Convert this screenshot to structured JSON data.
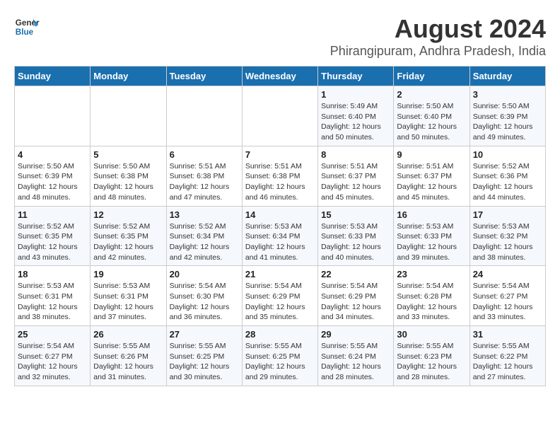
{
  "logo": {
    "line1": "General",
    "line2": "Blue"
  },
  "title": "August 2024",
  "subtitle": "Phirangipuram, Andhra Pradesh, India",
  "weekdays": [
    "Sunday",
    "Monday",
    "Tuesday",
    "Wednesday",
    "Thursday",
    "Friday",
    "Saturday"
  ],
  "weeks": [
    [
      {
        "day": "",
        "info": ""
      },
      {
        "day": "",
        "info": ""
      },
      {
        "day": "",
        "info": ""
      },
      {
        "day": "",
        "info": ""
      },
      {
        "day": "1",
        "info": "Sunrise: 5:49 AM\nSunset: 6:40 PM\nDaylight: 12 hours\nand 50 minutes."
      },
      {
        "day": "2",
        "info": "Sunrise: 5:50 AM\nSunset: 6:40 PM\nDaylight: 12 hours\nand 50 minutes."
      },
      {
        "day": "3",
        "info": "Sunrise: 5:50 AM\nSunset: 6:39 PM\nDaylight: 12 hours\nand 49 minutes."
      }
    ],
    [
      {
        "day": "4",
        "info": "Sunrise: 5:50 AM\nSunset: 6:39 PM\nDaylight: 12 hours\nand 48 minutes."
      },
      {
        "day": "5",
        "info": "Sunrise: 5:50 AM\nSunset: 6:38 PM\nDaylight: 12 hours\nand 48 minutes."
      },
      {
        "day": "6",
        "info": "Sunrise: 5:51 AM\nSunset: 6:38 PM\nDaylight: 12 hours\nand 47 minutes."
      },
      {
        "day": "7",
        "info": "Sunrise: 5:51 AM\nSunset: 6:38 PM\nDaylight: 12 hours\nand 46 minutes."
      },
      {
        "day": "8",
        "info": "Sunrise: 5:51 AM\nSunset: 6:37 PM\nDaylight: 12 hours\nand 45 minutes."
      },
      {
        "day": "9",
        "info": "Sunrise: 5:51 AM\nSunset: 6:37 PM\nDaylight: 12 hours\nand 45 minutes."
      },
      {
        "day": "10",
        "info": "Sunrise: 5:52 AM\nSunset: 6:36 PM\nDaylight: 12 hours\nand 44 minutes."
      }
    ],
    [
      {
        "day": "11",
        "info": "Sunrise: 5:52 AM\nSunset: 6:35 PM\nDaylight: 12 hours\nand 43 minutes."
      },
      {
        "day": "12",
        "info": "Sunrise: 5:52 AM\nSunset: 6:35 PM\nDaylight: 12 hours\nand 42 minutes."
      },
      {
        "day": "13",
        "info": "Sunrise: 5:52 AM\nSunset: 6:34 PM\nDaylight: 12 hours\nand 42 minutes."
      },
      {
        "day": "14",
        "info": "Sunrise: 5:53 AM\nSunset: 6:34 PM\nDaylight: 12 hours\nand 41 minutes."
      },
      {
        "day": "15",
        "info": "Sunrise: 5:53 AM\nSunset: 6:33 PM\nDaylight: 12 hours\nand 40 minutes."
      },
      {
        "day": "16",
        "info": "Sunrise: 5:53 AM\nSunset: 6:33 PM\nDaylight: 12 hours\nand 39 minutes."
      },
      {
        "day": "17",
        "info": "Sunrise: 5:53 AM\nSunset: 6:32 PM\nDaylight: 12 hours\nand 38 minutes."
      }
    ],
    [
      {
        "day": "18",
        "info": "Sunrise: 5:53 AM\nSunset: 6:31 PM\nDaylight: 12 hours\nand 38 minutes."
      },
      {
        "day": "19",
        "info": "Sunrise: 5:53 AM\nSunset: 6:31 PM\nDaylight: 12 hours\nand 37 minutes."
      },
      {
        "day": "20",
        "info": "Sunrise: 5:54 AM\nSunset: 6:30 PM\nDaylight: 12 hours\nand 36 minutes."
      },
      {
        "day": "21",
        "info": "Sunrise: 5:54 AM\nSunset: 6:29 PM\nDaylight: 12 hours\nand 35 minutes."
      },
      {
        "day": "22",
        "info": "Sunrise: 5:54 AM\nSunset: 6:29 PM\nDaylight: 12 hours\nand 34 minutes."
      },
      {
        "day": "23",
        "info": "Sunrise: 5:54 AM\nSunset: 6:28 PM\nDaylight: 12 hours\nand 33 minutes."
      },
      {
        "day": "24",
        "info": "Sunrise: 5:54 AM\nSunset: 6:27 PM\nDaylight: 12 hours\nand 33 minutes."
      }
    ],
    [
      {
        "day": "25",
        "info": "Sunrise: 5:54 AM\nSunset: 6:27 PM\nDaylight: 12 hours\nand 32 minutes."
      },
      {
        "day": "26",
        "info": "Sunrise: 5:55 AM\nSunset: 6:26 PM\nDaylight: 12 hours\nand 31 minutes."
      },
      {
        "day": "27",
        "info": "Sunrise: 5:55 AM\nSunset: 6:25 PM\nDaylight: 12 hours\nand 30 minutes."
      },
      {
        "day": "28",
        "info": "Sunrise: 5:55 AM\nSunset: 6:25 PM\nDaylight: 12 hours\nand 29 minutes."
      },
      {
        "day": "29",
        "info": "Sunrise: 5:55 AM\nSunset: 6:24 PM\nDaylight: 12 hours\nand 28 minutes."
      },
      {
        "day": "30",
        "info": "Sunrise: 5:55 AM\nSunset: 6:23 PM\nDaylight: 12 hours\nand 28 minutes."
      },
      {
        "day": "31",
        "info": "Sunrise: 5:55 AM\nSunset: 6:22 PM\nDaylight: 12 hours\nand 27 minutes."
      }
    ]
  ]
}
